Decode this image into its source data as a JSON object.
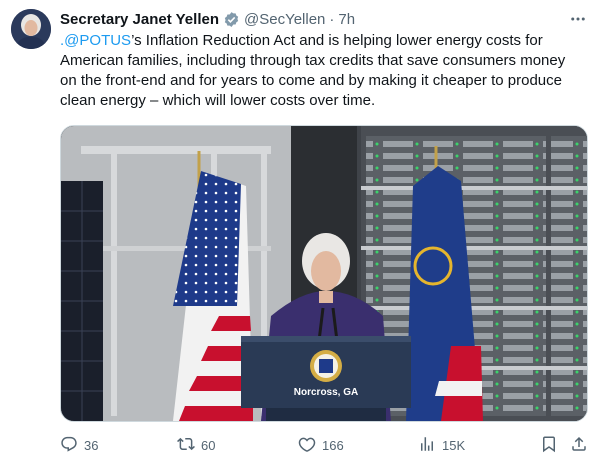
{
  "author": {
    "name": "Secretary Janet Yellen",
    "handle": "@SecYellen",
    "separator": "·",
    "time": "7h"
  },
  "tweet": {
    "mention": ".@POTUS",
    "body": "’s Inflation Reduction Act and is helping lower energy costs for American families, including through tax credits that save consumers money on the front-end and for years to come and by making it cheaper to produce clean energy – which will lower costs over time."
  },
  "media": {
    "podium_location": "Norcross, GA"
  },
  "stats": {
    "replies": "36",
    "retweets": "60",
    "likes": "166",
    "views": "15K"
  },
  "colors": {
    "accent": "#1d9bf0",
    "secondary_text": "#536471",
    "verified": "#829aab"
  },
  "icons": [
    "verified-badge-icon",
    "more-icon",
    "reply-icon",
    "retweet-icon",
    "like-icon",
    "views-icon",
    "bookmark-icon",
    "share-icon"
  ]
}
